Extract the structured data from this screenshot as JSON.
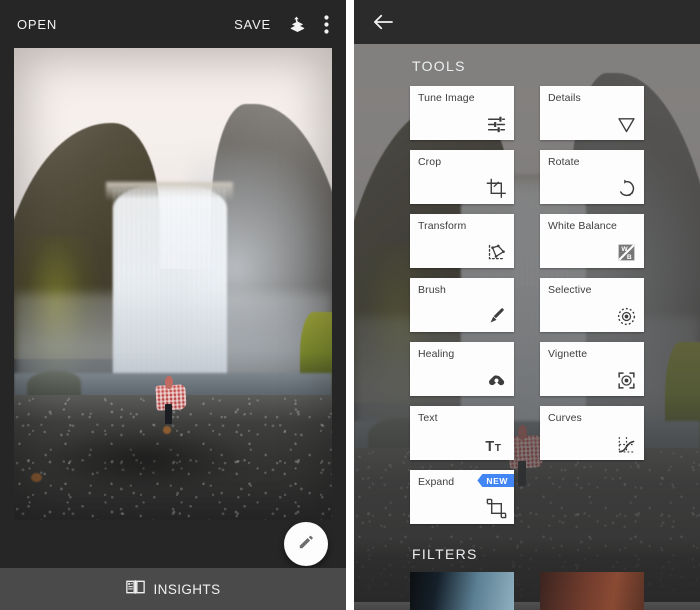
{
  "editor": {
    "topbar": {
      "open_label": "OPEN",
      "save_label": "SAVE",
      "stack_icon": "layers-undo-icon",
      "menu_icon": "more-vert-icon"
    },
    "photo": {
      "alt": "waterfall-photo",
      "subject": "Waterfall with person in red checkered blanket on black rock beach"
    },
    "fab": {
      "icon": "pencil-icon",
      "name": "edit-fab"
    },
    "bottom_bar": {
      "insights_label": "INSIGHTS",
      "insights_icon": "book-icon"
    }
  },
  "tools_panel": {
    "back_icon": "arrow-left-icon",
    "tools_heading": "TOOLS",
    "filters_heading": "FILTERS",
    "badge_new": "NEW",
    "tools": [
      {
        "label": "Tune Image",
        "icon": "sliders-icon",
        "badge": null
      },
      {
        "label": "Details",
        "icon": "triangle-down-icon",
        "badge": null
      },
      {
        "label": "Crop",
        "icon": "crop-icon",
        "badge": null
      },
      {
        "label": "Rotate",
        "icon": "rotate-icon",
        "badge": null
      },
      {
        "label": "Transform",
        "icon": "transform-icon",
        "badge": null
      },
      {
        "label": "White Balance",
        "icon": "white-balance-icon",
        "badge": null
      },
      {
        "label": "Brush",
        "icon": "brush-icon",
        "badge": null
      },
      {
        "label": "Selective",
        "icon": "selective-icon",
        "badge": null
      },
      {
        "label": "Healing",
        "icon": "healing-icon",
        "badge": null
      },
      {
        "label": "Vignette",
        "icon": "vignette-icon",
        "badge": null
      },
      {
        "label": "Text",
        "icon": "text-icon",
        "badge": null
      },
      {
        "label": "Curves",
        "icon": "curves-icon",
        "badge": null
      },
      {
        "label": "Expand",
        "icon": "expand-icon",
        "badge": "NEW"
      }
    ],
    "filters": [
      {
        "name": "filter-thumb-1",
        "tone": "cool"
      },
      {
        "name": "filter-thumb-2",
        "tone": "warm"
      }
    ]
  },
  "colors": {
    "topbar_bg": "#262626",
    "panel_bg": "#262626",
    "card_bg": "#fdfdfd",
    "badge_blue": "#4285f4",
    "insights_bar": "#4a4a4a",
    "text_light": "#f2f2f2",
    "text_dark": "#3d3d3d"
  }
}
